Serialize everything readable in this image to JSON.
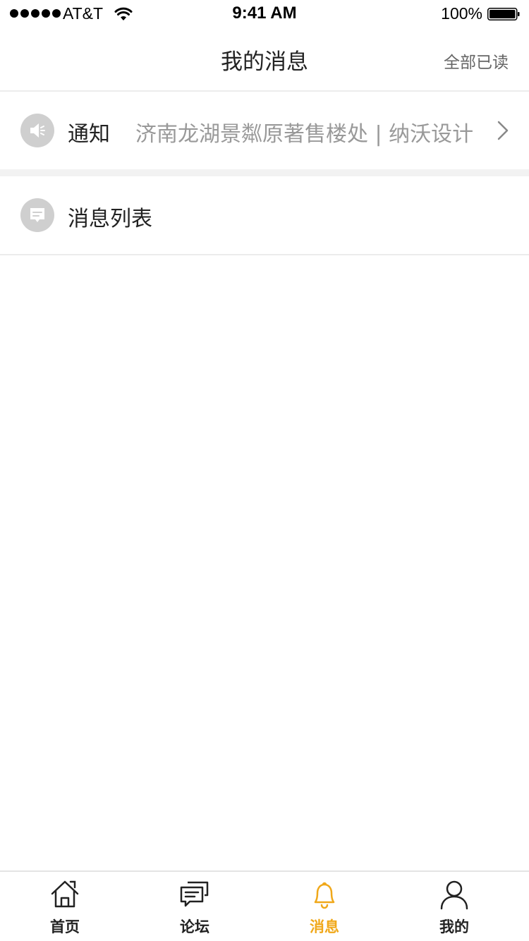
{
  "status_bar": {
    "carrier": "AT&T",
    "time": "9:41 AM",
    "battery": "100%"
  },
  "nav": {
    "title": "我的消息",
    "mark_all_read": "全部已读"
  },
  "rows": {
    "notice": {
      "label": "通知",
      "preview": "济南龙湖景粼原著售楼处 | 纳沃设计",
      "icon": "speaker-icon"
    },
    "messages": {
      "label": "消息列表",
      "icon": "chat-icon"
    }
  },
  "tabs": [
    {
      "label": "首页",
      "icon": "home-icon",
      "active": false
    },
    {
      "label": "论坛",
      "icon": "forum-icon",
      "active": false
    },
    {
      "label": "消息",
      "icon": "bell-icon",
      "active": true
    },
    {
      "label": "我的",
      "icon": "user-icon",
      "active": false
    }
  ],
  "colors": {
    "accent": "#f0a81a",
    "icon_bg": "#cfcfcf",
    "divider": "#ececec",
    "muted_text": "#999999"
  }
}
